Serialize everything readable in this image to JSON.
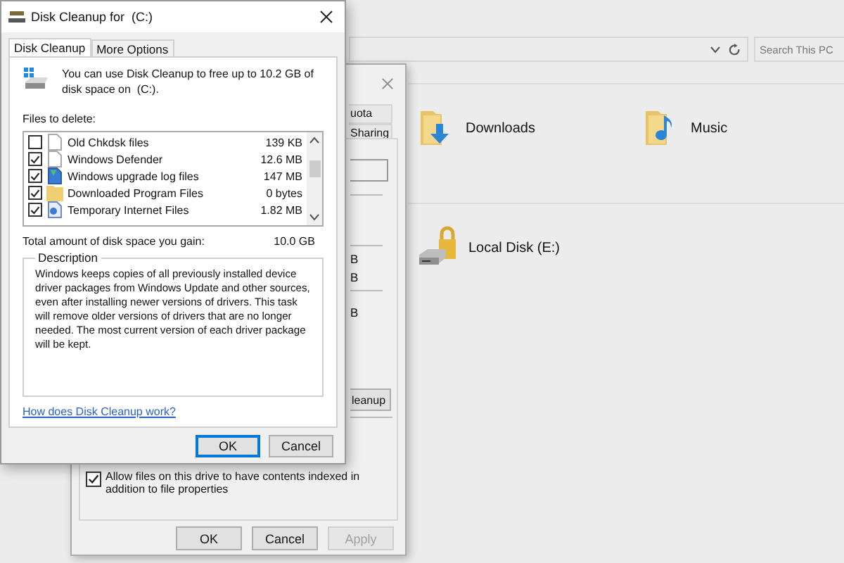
{
  "explorer": {
    "search": {
      "placeholder": "Search This PC"
    },
    "items": [
      {
        "label": "Downloads",
        "kind": "downloads"
      },
      {
        "label": "Music",
        "kind": "music"
      },
      {
        "label": "Local Disk (E:)",
        "kind": "locked-drive"
      }
    ]
  },
  "properties_dialog": {
    "tabs": [
      {
        "label": "uota",
        "selected": false
      },
      {
        "label": "Sharing",
        "selected": false
      }
    ],
    "fragments": [
      "B",
      "B",
      "B"
    ],
    "cleanup_button": "leanup",
    "index_checkbox": {
      "label": "Allow files on this drive to have contents indexed in addition to file properties",
      "checked": true
    },
    "buttons": [
      {
        "label": "OK",
        "disabled": false
      },
      {
        "label": "Cancel",
        "disabled": false
      },
      {
        "label": "Apply",
        "disabled": true
      }
    ]
  },
  "cleanup_dialog": {
    "title": "Disk Cleanup for  (C:)",
    "tabs": [
      {
        "label": "Disk Cleanup",
        "selected": true
      },
      {
        "label": "More Options",
        "selected": false
      }
    ],
    "intro": "You can use Disk Cleanup to free up to 10.2 GB of disk space on  (C:).",
    "files_label": "Files to delete:",
    "files": [
      {
        "name": "Old Chkdsk files",
        "size": "139 KB",
        "checked": false,
        "kind": "page"
      },
      {
        "name": "Windows Defender",
        "size": "12.6 MB",
        "checked": true,
        "kind": "page"
      },
      {
        "name": "Windows upgrade log files",
        "size": "147 MB",
        "checked": true,
        "kind": "log"
      },
      {
        "name": "Downloaded Program Files",
        "size": "0 bytes",
        "checked": true,
        "kind": "folder"
      },
      {
        "name": "Temporary Internet Files",
        "size": "1.82 MB",
        "checked": true,
        "kind": "web"
      }
    ],
    "total_label": "Total amount of disk space you gain:",
    "total": "10.0 GB",
    "description_title": "Description",
    "description": "Windows keeps copies of all previously installed device driver packages from Windows Update and other sources, even after installing newer versions of drivers. This task will remove older versions of drivers that are no longer needed. The most current version of each driver package will be kept.",
    "help_link": "How does Disk Cleanup work?",
    "buttons": [
      {
        "label": "OK",
        "default": true
      },
      {
        "label": "Cancel",
        "default": false
      }
    ]
  }
}
